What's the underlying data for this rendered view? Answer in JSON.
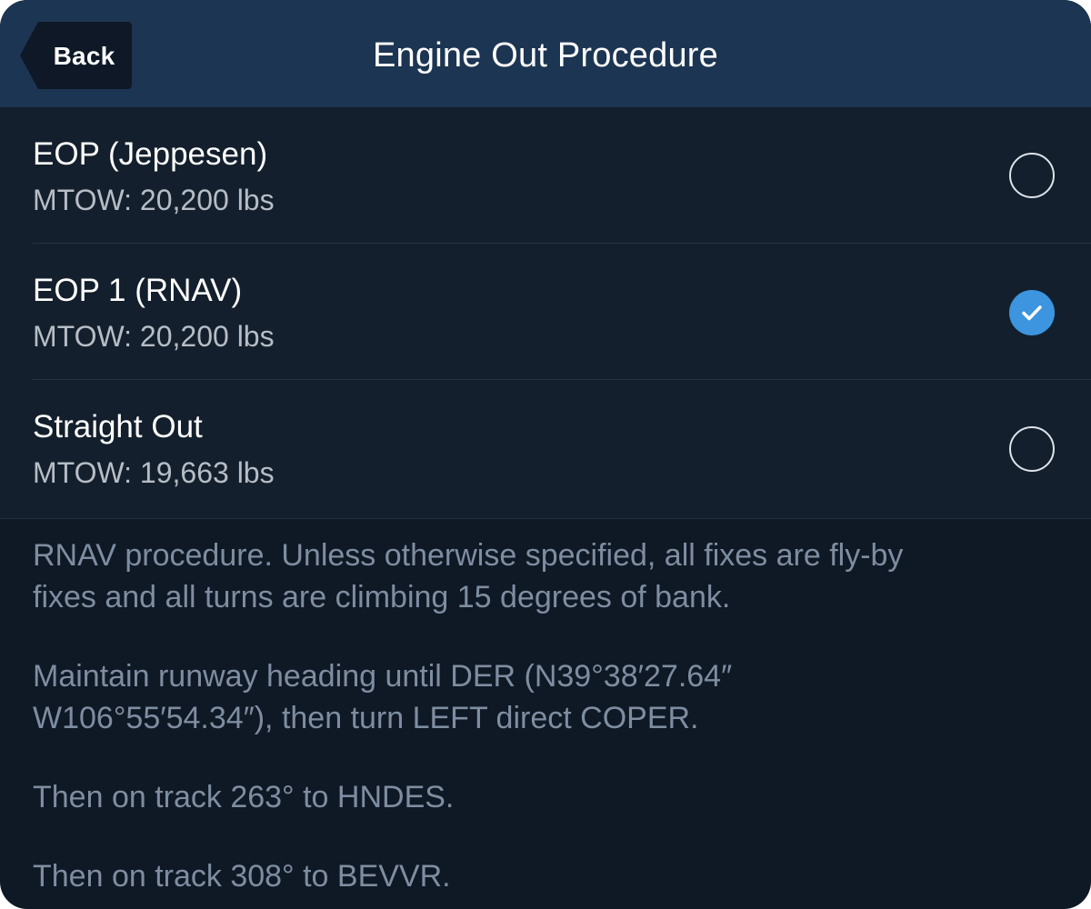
{
  "nav": {
    "back_label": "Back",
    "title": "Engine Out Procedure"
  },
  "options": [
    {
      "title": "EOP (Jeppesen)",
      "subtitle": "MTOW: 20,200 lbs",
      "selected": false
    },
    {
      "title": "EOP 1 (RNAV)",
      "subtitle": "MTOW: 20,200 lbs",
      "selected": true
    },
    {
      "title": "Straight Out",
      "subtitle": "MTOW: 19,663 lbs",
      "selected": false
    }
  ],
  "description": {
    "p1_line1": "RNAV procedure. Unless otherwise specified, all fixes are fly-by",
    "p1_line2": "fixes and all turns are climbing 15 degrees of bank.",
    "p2_line1": "Maintain runway heading until DER (N39°38′27.64″",
    "p2_line2": "W106°55′54.34″), then turn LEFT direct COPER.",
    "p3": "Then on track 263° to HNDES.",
    "p4": "Then on track 308° to BEVVR."
  },
  "colors": {
    "nav_background": "#1c3552",
    "back_button": "#0e1826",
    "list_background": "#131f2c",
    "page_background": "#0f1825",
    "selected_accent": "#3c95de",
    "description_text": "#7e8da0"
  }
}
